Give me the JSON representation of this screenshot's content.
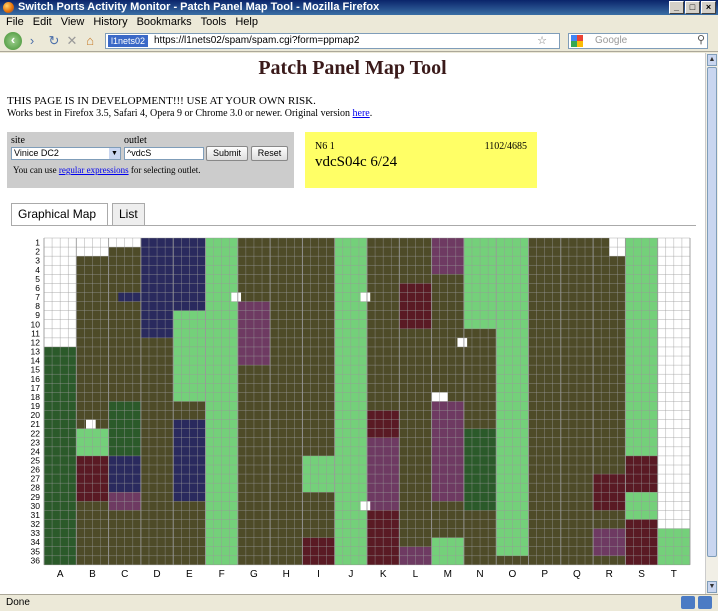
{
  "window": {
    "title": "Switch Ports Activity Monitor - Patch Panel Map Tool - Mozilla Firefox"
  },
  "menu": [
    "File",
    "Edit",
    "View",
    "History",
    "Bookmarks",
    "Tools",
    "Help"
  ],
  "nav": {
    "identity": "l1nets02",
    "url": "https://l1nets02/spam/spam.cgi?form=ppmap2",
    "search_placeholder": "Google"
  },
  "page": {
    "title": "Patch Panel Map Tool",
    "warning": "THIS PAGE IS IN DEVELOPMENT!!! USE AT YOUR OWN RISK.",
    "compat": "Works best in Firefox 3.5, Safari 4, Opera 9 or Chrome 3.0 or newer. Original version",
    "compat_link": "here",
    "compat_end": ".",
    "form": {
      "site_label": "site",
      "site_value": "Vinice DC2",
      "outlet_label": "outlet",
      "outlet_value": "^vdcS",
      "submit": "Submit",
      "reset": "Reset",
      "help_pre": "You can use",
      "help_link": "regular expressions",
      "help_post": "for selecting outlet."
    },
    "info": {
      "panel": "N6 1",
      "count": "1102/4685",
      "outlet": "vdcS04c 6/24"
    },
    "tabs": [
      "Graphical Map",
      "List"
    ]
  },
  "status": {
    "text": "Done"
  },
  "colors": {
    "inactive": "#4e4b28",
    "active": "#74d07a",
    "navy": "#2a2a5e",
    "maroon": "#5a1a24",
    "purple": "#6e3a62",
    "green": "#2b5a2a",
    "empty": "#ffffff",
    "grid": "#999999"
  },
  "grid": {
    "columns": [
      "A",
      "B",
      "C",
      "D",
      "E",
      "F",
      "G",
      "H",
      "I",
      "J",
      "K",
      "L",
      "M",
      "N",
      "O",
      "P",
      "Q",
      "R",
      "S",
      "T"
    ],
    "rows": [
      "1",
      "2",
      "3",
      "4",
      "5",
      "6",
      "7",
      "8",
      "9",
      "10",
      "11",
      "12",
      "13",
      "14",
      "15",
      "16",
      "17",
      "18",
      "19",
      "20",
      "21",
      "22",
      "23",
      "24",
      "25",
      "26",
      "27",
      "28",
      "29",
      "30",
      "31",
      "32",
      "33",
      "34",
      "35",
      "36"
    ],
    "regions": [
      {
        "c": "empty",
        "col": [
          0,
          1
        ],
        "row": [
          1,
          12
        ]
      },
      {
        "c": "empty",
        "col": [
          1,
          3
        ],
        "row": [
          1,
          1
        ]
      },
      {
        "c": "empty",
        "col": [
          1,
          2
        ],
        "row": [
          2,
          2
        ]
      },
      {
        "c": "empty",
        "col": [
          2,
          3
        ],
        "row": [
          1,
          1
        ]
      },
      {
        "c": "empty",
        "col": [
          17.5,
          19
        ],
        "row": [
          1,
          2
        ]
      },
      {
        "c": "empty",
        "col": [
          19,
          20
        ],
        "row": [
          1,
          34
        ]
      },
      {
        "c": "active",
        "col": [
          5,
          6
        ],
        "row": [
          1,
          36
        ]
      },
      {
        "c": "active",
        "col": [
          9,
          10
        ],
        "row": [
          1,
          36
        ]
      },
      {
        "c": "active",
        "col": [
          13,
          14
        ],
        "row": [
          1,
          10
        ]
      },
      {
        "c": "active",
        "col": [
          14,
          15
        ],
        "row": [
          1,
          35
        ]
      },
      {
        "c": "active",
        "col": [
          18,
          19
        ],
        "row": [
          1,
          24
        ]
      },
      {
        "c": "navy",
        "col": [
          3,
          5
        ],
        "row": [
          1,
          8
        ]
      },
      {
        "c": "navy",
        "col": [
          3,
          4
        ],
        "row": [
          9,
          11
        ]
      },
      {
        "c": "navy",
        "col": [
          2.3,
          3
        ],
        "row": [
          7,
          7
        ]
      },
      {
        "c": "active",
        "col": [
          4,
          5
        ],
        "row": [
          9,
          12
        ]
      },
      {
        "c": "active",
        "col": [
          4,
          5
        ],
        "row": [
          13,
          18
        ]
      },
      {
        "c": "purple",
        "col": [
          6,
          7
        ],
        "row": [
          8,
          14
        ]
      },
      {
        "c": "purple",
        "col": [
          12,
          13
        ],
        "row": [
          1,
          4
        ]
      },
      {
        "c": "maroon",
        "col": [
          11,
          12
        ],
        "row": [
          6,
          10
        ]
      },
      {
        "c": "purple",
        "col": [
          12,
          13
        ],
        "row": [
          19,
          29
        ]
      },
      {
        "c": "maroon",
        "col": [
          10,
          11
        ],
        "row": [
          20,
          36
        ]
      },
      {
        "c": "purple",
        "col": [
          10,
          11
        ],
        "row": [
          23,
          30
        ]
      },
      {
        "c": "green",
        "col": [
          0,
          1
        ],
        "row": [
          13,
          36
        ]
      },
      {
        "c": "green",
        "col": [
          2,
          3
        ],
        "row": [
          19,
          30
        ]
      },
      {
        "c": "maroon",
        "col": [
          1,
          2
        ],
        "row": [
          25,
          29
        ]
      },
      {
        "c": "navy",
        "col": [
          2,
          3
        ],
        "row": [
          25,
          28
        ]
      },
      {
        "c": "purple",
        "col": [
          2,
          3
        ],
        "row": [
          29,
          30
        ]
      },
      {
        "c": "navy",
        "col": [
          4,
          5
        ],
        "row": [
          21,
          29
        ]
      },
      {
        "c": "active",
        "col": [
          1,
          2
        ],
        "row": [
          22,
          24
        ]
      },
      {
        "c": "active",
        "col": [
          8,
          9
        ],
        "row": [
          25,
          28
        ]
      },
      {
        "c": "green",
        "col": [
          13,
          14
        ],
        "row": [
          22,
          30
        ]
      },
      {
        "c": "maroon",
        "col": [
          18,
          19
        ],
        "row": [
          25,
          36
        ]
      },
      {
        "c": "maroon",
        "col": [
          17,
          18
        ],
        "row": [
          27,
          30
        ]
      },
      {
        "c": "active",
        "col": [
          18,
          19
        ],
        "row": [
          29,
          31
        ]
      },
      {
        "c": "purple",
        "col": [
          17,
          18
        ],
        "row": [
          33,
          35
        ]
      },
      {
        "c": "active",
        "col": [
          19,
          20
        ],
        "row": [
          33,
          36
        ]
      },
      {
        "c": "maroon",
        "col": [
          8,
          9
        ],
        "row": [
          34,
          36
        ]
      },
      {
        "c": "active",
        "col": [
          12,
          13
        ],
        "row": [
          34,
          36
        ]
      },
      {
        "c": "purple",
        "col": [
          11,
          12
        ],
        "row": [
          35,
          36
        ]
      },
      {
        "c": "empty",
        "col": [
          12,
          12.5
        ],
        "row": [
          18,
          18
        ]
      },
      {
        "c": "empty",
        "col": [
          1.3,
          1.6
        ],
        "row": [
          21,
          21
        ]
      },
      {
        "c": "empty",
        "col": [
          5.8,
          6.1
        ],
        "row": [
          7,
          7
        ]
      },
      {
        "c": "empty",
        "col": [
          9.8,
          10.1
        ],
        "row": [
          7,
          7
        ]
      },
      {
        "c": "empty",
        "col": [
          12.8,
          13.1
        ],
        "row": [
          12,
          12
        ]
      },
      {
        "c": "empty",
        "col": [
          9.8,
          10.1
        ],
        "row": [
          30,
          30
        ]
      }
    ]
  }
}
